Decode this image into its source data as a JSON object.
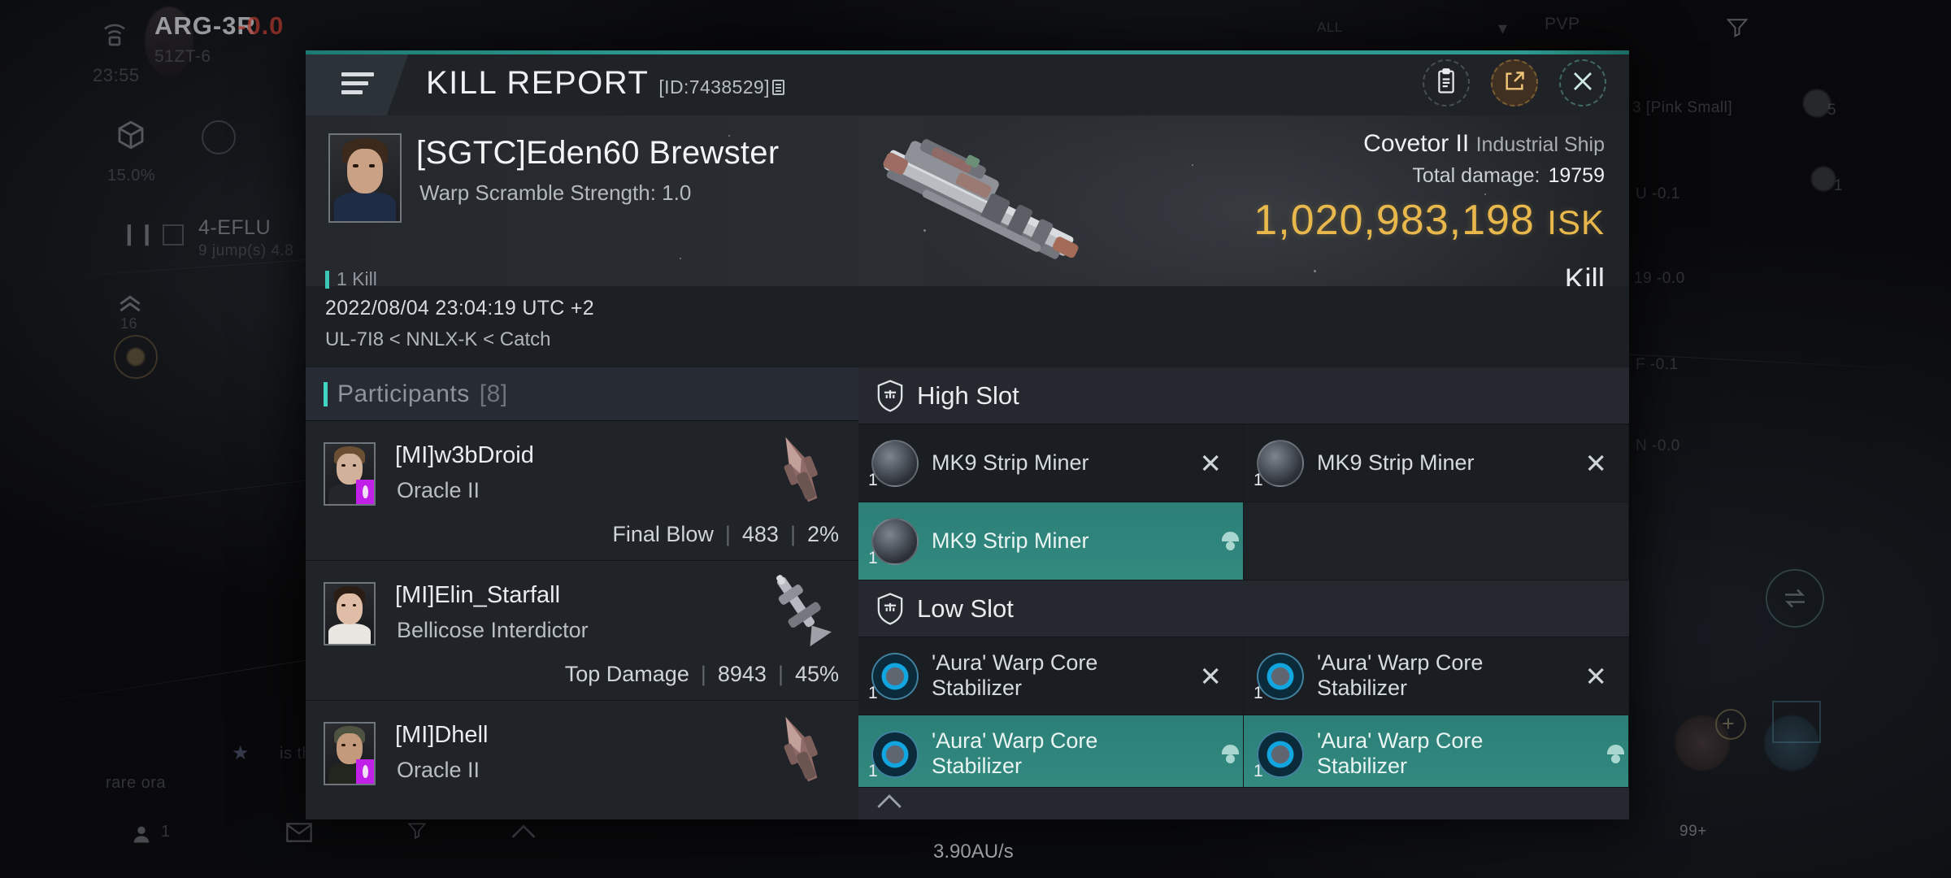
{
  "background": {
    "system_label": "ARG-3R",
    "system_sec": "-0.0",
    "station_label": "51ZT-6",
    "clock": "23:55",
    "cargo_pct": "15.0%",
    "dest_label": "4-EFLU",
    "dest_sub": "9 jump(s) 4.8",
    "speed": "3.90AU/s",
    "pvp_label": "PVP",
    "pvp_prefix": "ALL",
    "pink_small": "3 [Pink Small]",
    "right_entries": [
      "U -0.1",
      "19 -0.0",
      "F -0.1",
      "N -0.0"
    ],
    "chat_snippet_1": "is the",
    "chat_snippet_2": "rare ora",
    "member_count": "1",
    "notif_count": "99+",
    "hud_number_5": "5",
    "hud_number_1": "1",
    "warp_level": "16",
    "icons": [
      "wifi-icon",
      "cargo-cube-icon",
      "shield-slot-icon",
      "pause-icon",
      "stop-icon",
      "warp-chevrons-icon",
      "mail-icon",
      "filter-icon",
      "chevron-up-icon",
      "people-icon",
      "plus-icon",
      "scan-icon"
    ]
  },
  "header": {
    "title": "KILL REPORT",
    "report_id": "[ID:7438529]",
    "menu_icon": "hamburger-menu-icon",
    "copy_icon": "copy-icon",
    "actions": [
      {
        "name": "clipboard-button",
        "icon": "clipboard-icon"
      },
      {
        "name": "share-button",
        "icon": "external-link-icon"
      },
      {
        "name": "close-button",
        "icon": "close-x-icon"
      }
    ]
  },
  "victim": {
    "name": "[SGTC]Eden60 Brewster",
    "subtitle": "Warp Scramble Strength: 1.0",
    "kill_badge": "1 Kill",
    "datetime": "2022/08/04 23:04:19 UTC +2",
    "location": "UL-7I8 < NNLX-K < Catch",
    "ship_name": "Covetor II",
    "ship_class": "Industrial Ship",
    "damage_label": "Total damage:",
    "damage_value": "19759",
    "isk_value": "1,020,983,198",
    "isk_unit": "ISK",
    "result": "Kill",
    "portrait_icon": "victim-portrait",
    "ship_render_icon": "covetor-ship-render"
  },
  "participants": {
    "header_label": "Participants",
    "header_count": "[8]",
    "rows": [
      {
        "name": "[MI]w3bDroid",
        "ship": "Oracle II",
        "tag": "Final Blow",
        "damage": "483",
        "percent": "2%",
        "portrait_icon": "participant-portrait",
        "ship_thumb_icon": "oracle-ship-thumb"
      },
      {
        "name": "[MI]Elin_Starfall",
        "ship": "Bellicose Interdictor",
        "tag": "Top Damage",
        "damage": "8943",
        "percent": "45%",
        "portrait_icon": "participant-portrait",
        "ship_thumb_icon": "bellicose-ship-thumb"
      },
      {
        "name": "[MI]Dhell",
        "ship": "Oracle II",
        "tag": "",
        "damage": "",
        "percent": "",
        "portrait_icon": "participant-portrait",
        "ship_thumb_icon": "oracle-ship-thumb"
      }
    ]
  },
  "modules": {
    "sections": [
      {
        "title": "High Slot",
        "icon": "shield-slot-icon",
        "items": [
          {
            "name": "MK9 Strip Miner",
            "qty": "1",
            "mark": "x-mark",
            "selected": false,
            "icon": "strip-miner-icon"
          },
          {
            "name": "MK9 Strip Miner",
            "qty": "1",
            "mark": "x-mark",
            "selected": false,
            "icon": "strip-miner-icon"
          },
          {
            "name": "MK9 Strip Miner",
            "qty": "1",
            "mark": "user-mark",
            "selected": true,
            "icon": "strip-miner-icon"
          },
          {
            "name": "",
            "qty": "",
            "mark": "",
            "selected": false,
            "icon": ""
          }
        ]
      },
      {
        "title": "Low Slot",
        "icon": "shield-slot-icon",
        "items": [
          {
            "name": "'Aura' Warp Core Stabilizer",
            "qty": "1",
            "mark": "x-mark",
            "selected": false,
            "icon": "warp-core-stabilizer-icon"
          },
          {
            "name": "'Aura' Warp Core Stabilizer",
            "qty": "1",
            "mark": "x-mark",
            "selected": false,
            "icon": "warp-core-stabilizer-icon"
          },
          {
            "name": "'Aura' Warp Core Stabilizer",
            "qty": "1",
            "mark": "user-mark",
            "selected": true,
            "icon": "warp-core-stabilizer-icon"
          },
          {
            "name": "'Aura' Warp Core Stabilizer",
            "qty": "1",
            "mark": "user-mark",
            "selected": true,
            "icon": "warp-core-stabilizer-icon"
          }
        ]
      }
    ],
    "partial_section_icon": "chevron-up-icon"
  },
  "colors": {
    "accent_teal": "#2e9b91",
    "selected_teal": "#338a7f",
    "isk_gold": "#e9b84c",
    "panel_bg": "#1c1f23",
    "badge_purple": "#c020e8"
  }
}
